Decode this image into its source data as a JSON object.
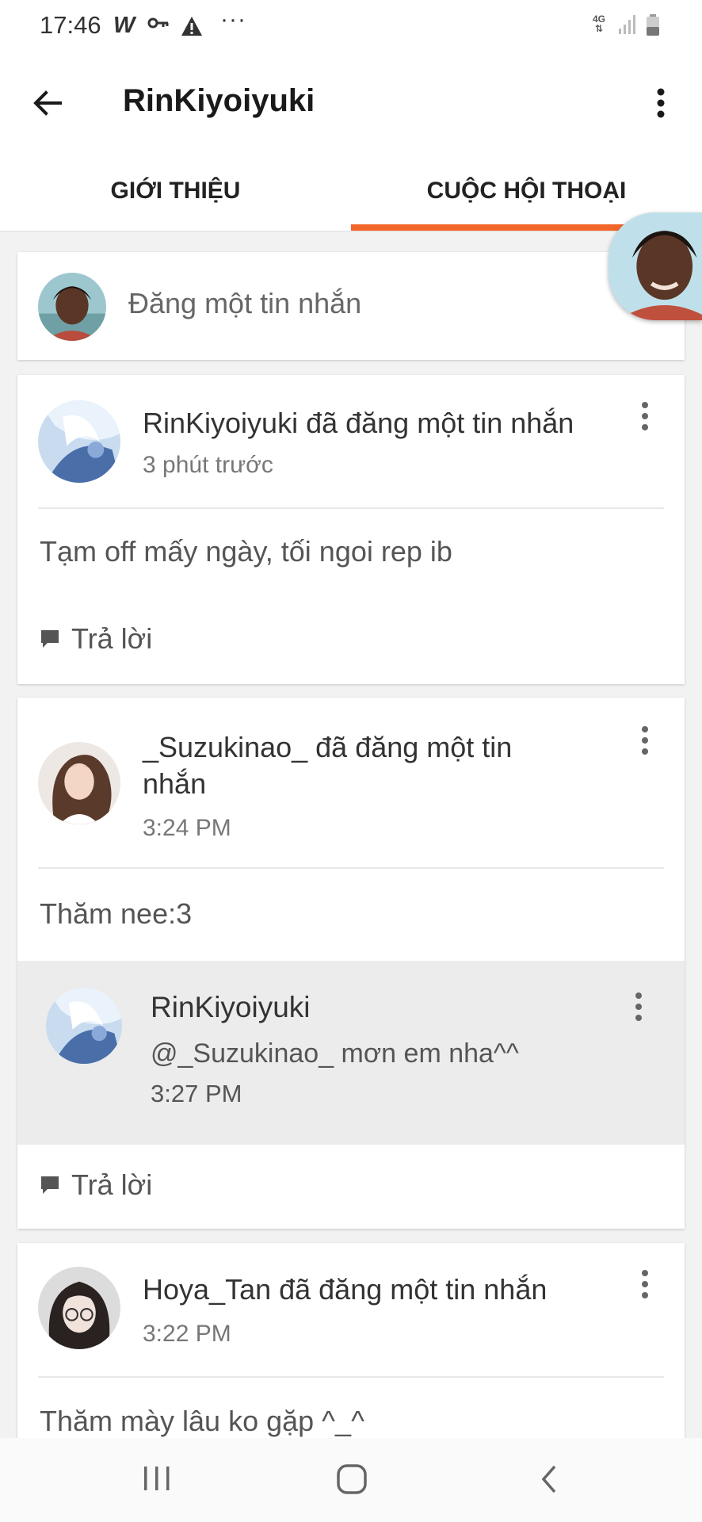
{
  "status_bar": {
    "time": "17:46",
    "network": "4G",
    "icons": [
      "w-app-icon",
      "key-icon",
      "warning-icon",
      "more-dots-icon",
      "signal-icon",
      "battery-icon"
    ]
  },
  "header": {
    "title": "RinKiyoiyuki",
    "back_icon": "arrow-left-icon",
    "menu_icon": "more-vertical-icon"
  },
  "tabs": [
    {
      "label": "GIỚI THIỆU",
      "active": false
    },
    {
      "label": "CUỘC HỘI THOẠI",
      "active": true
    }
  ],
  "accent_color": "#f2662a",
  "compose": {
    "placeholder": "Đăng một tin nhắn"
  },
  "posts": [
    {
      "author_line": "RinKiyoiyuki đã đăng một tin nhắn",
      "time": "3 phút trước",
      "body": "Tạm off mấy ngày, tối ngoi rep ib",
      "reply_label": "Trả lời"
    },
    {
      "author_line_1": "_Suzukinao_ đã đăng một tin",
      "author_line_2": "nhắn",
      "time": "3:24 PM",
      "body": "Thăm nee:3",
      "reply": {
        "author": "RinKiyoiyuki",
        "text": "@_Suzukinao_  mơn em nha^^",
        "time": "3:27 PM"
      },
      "reply_label": "Trả lời"
    },
    {
      "author_line": "Hoya_Tan đã đăng một tin nhắn",
      "time": "3:22 PM",
      "body": "Thăm mày lâu ko gặp ^_^"
    }
  ]
}
